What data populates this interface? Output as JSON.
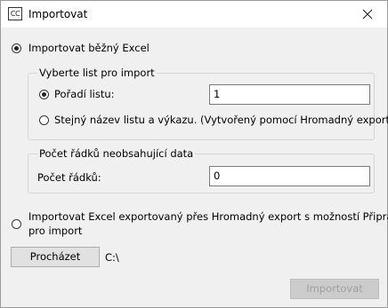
{
  "window": {
    "title": "Importovat",
    "icon_text": "CC"
  },
  "options": {
    "option1_label": "Importovat běžný Excel",
    "sheet_group": {
      "legend": "Vyberte list pro import",
      "order_label": "Pořadí listu:",
      "order_value": "1",
      "same_name_label": "Stejný název listu a výkazu. (Vytvořený pomocí Hromadný export)"
    },
    "rows_group": {
      "legend": "Počet řádků neobsahující data",
      "rows_label": "Počet řádků:",
      "rows_value": "0"
    },
    "option2_label_line1": "Importovat Excel exportovaný přes Hromadný export s možností Připravit",
    "option2_label_line2": "pro import"
  },
  "browse": {
    "button_label": "Procházet",
    "path": "C:\\"
  },
  "footer": {
    "import_label": "Importovat"
  }
}
